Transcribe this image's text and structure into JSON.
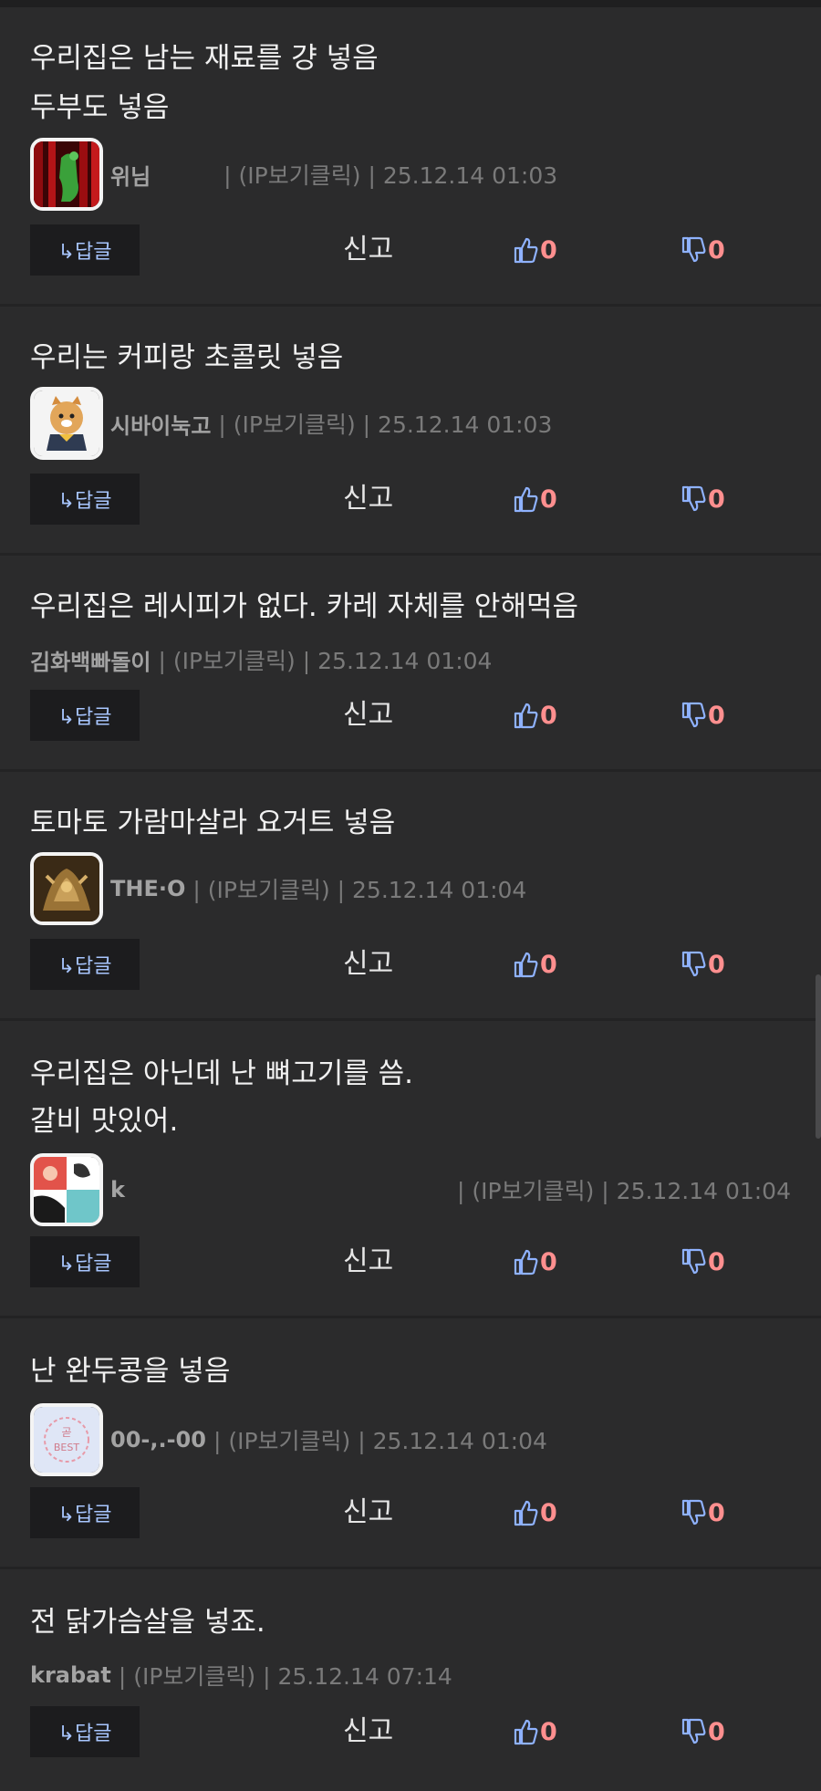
{
  "comments": [
    {
      "lines": [
        "우리집은 남는 재료를 걍 넣음",
        "두부도 넣음"
      ],
      "nick": "위님",
      "meta": "| (IP보기클릭) | 25.12.14 01:03",
      "reply": "↳답글",
      "report": "신고",
      "up": "0",
      "down": "0",
      "avatar_icon": "red-curtain-green-figure-avatar"
    },
    {
      "lines": [
        "우리는 커피랑 초콜릿 넣음"
      ],
      "nick": "시바이눅고",
      "meta": "| (IP보기클릭) | 25.12.14 01:03",
      "reply": "↳답글",
      "report": "신고",
      "up": "0",
      "down": "0",
      "avatar_icon": "shiba-dog-avatar"
    },
    {
      "lines": [
        "우리집은 레시피가 없다. 카레 자체를 안해먹음"
      ],
      "nick": "김화백빠돌이",
      "meta": "| (IP보기클릭) | 25.12.14 01:04",
      "reply": "↳답글",
      "report": "신고",
      "up": "0",
      "down": "0"
    },
    {
      "lines": [
        "토마토 가람마살라 요거트 넣음"
      ],
      "nick": "THE·O",
      "meta": "| (IP보기클릭) | 25.12.14 01:04",
      "reply": "↳답글",
      "report": "신고",
      "up": "0",
      "down": "0",
      "avatar_icon": "golden-armor-avatar"
    },
    {
      "lines": [
        "우리집은 아닌데 난 뼈고기를 씀.",
        "갈비 맛있어."
      ],
      "nick": "k",
      "meta": "| (IP보기클릭) | 25.12.14 01:04",
      "reply": "↳답글",
      "report": "신고",
      "up": "0",
      "down": "0",
      "avatar_icon": "collage-avatar"
    },
    {
      "lines": [
        "난 완두콩을 넣음"
      ],
      "nick": "00-,.-00",
      "meta": "| (IP보기클릭) | 25.12.14 01:04",
      "reply": "↳답글",
      "report": "신고",
      "up": "0",
      "down": "0",
      "avatar_icon": "best-stamp-avatar",
      "avatar_text": [
        "곧",
        "BEST"
      ]
    },
    {
      "lines": [
        "전 닭가슴살을 넣죠."
      ],
      "nick": "krabat",
      "meta": "| (IP보기클릭) | 25.12.14 07:14",
      "reply": "↳답글",
      "report": "신고",
      "up": "0",
      "down": "0"
    }
  ],
  "colors": {
    "background": "#2b2b2c",
    "reply_text": "#a8c6ff",
    "vote_count": "#ff8f8f",
    "thumb_icon": "#8fb2ff"
  }
}
